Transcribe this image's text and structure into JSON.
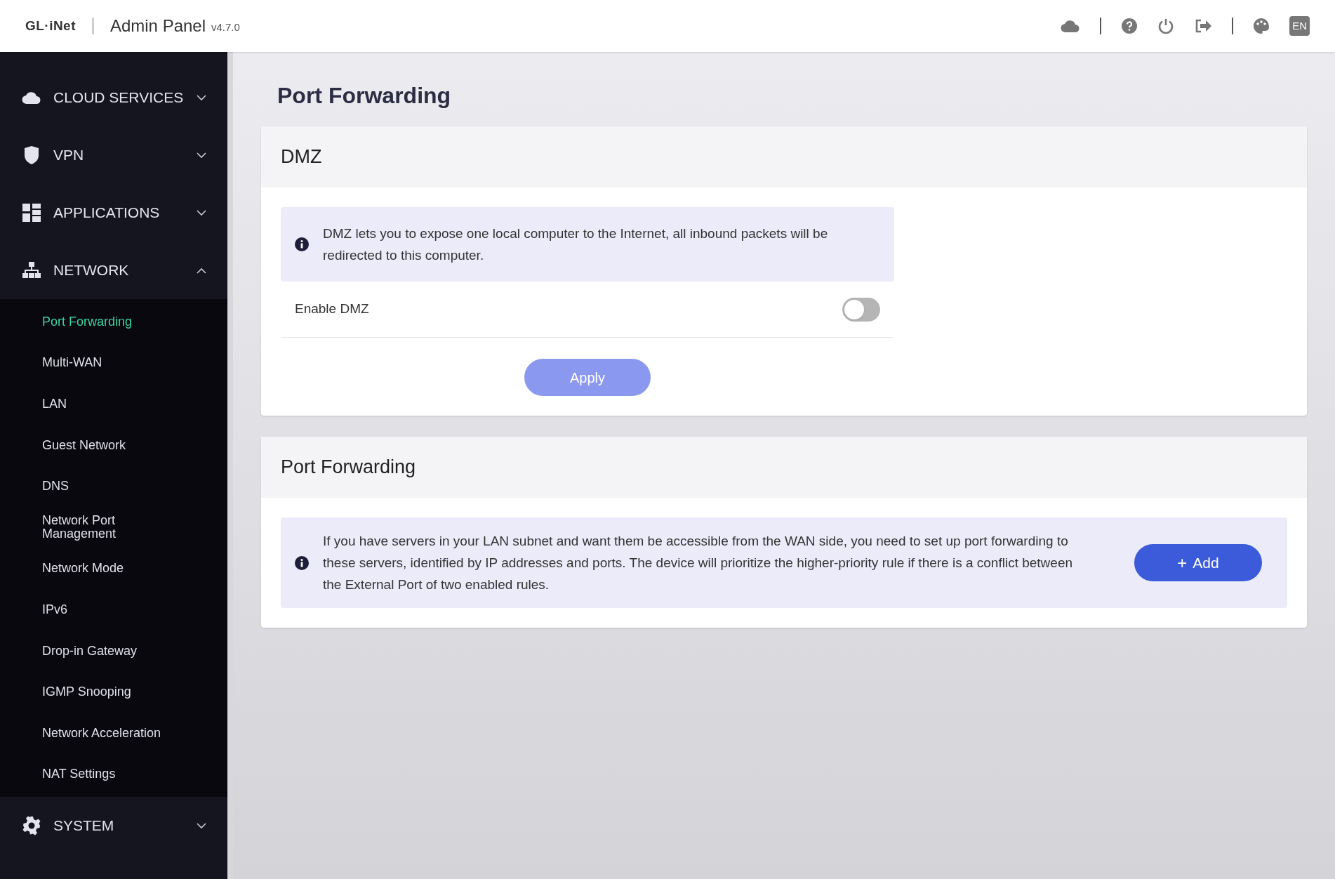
{
  "header": {
    "logo": "GL·iNet",
    "title": "Admin Panel",
    "version": "v4.7.0",
    "language": "EN"
  },
  "sidebar": {
    "groups": [
      {
        "label": "CLOUD SERVICES",
        "expanded": false
      },
      {
        "label": "VPN",
        "expanded": false
      },
      {
        "label": "APPLICATIONS",
        "expanded": false
      },
      {
        "label": "NETWORK",
        "expanded": true,
        "children": [
          {
            "label": "Port Forwarding",
            "selected": true
          },
          {
            "label": "Multi-WAN",
            "selected": false
          },
          {
            "label": "LAN",
            "selected": false
          },
          {
            "label": "Guest Network",
            "selected": false
          },
          {
            "label": "DNS",
            "selected": false
          },
          {
            "label": "Network Port Management",
            "selected": false
          },
          {
            "label": "Network Mode",
            "selected": false
          },
          {
            "label": "IPv6",
            "selected": false
          },
          {
            "label": "Drop-in Gateway",
            "selected": false
          },
          {
            "label": "IGMP Snooping",
            "selected": false
          },
          {
            "label": "Network Acceleration",
            "selected": false
          },
          {
            "label": "NAT Settings",
            "selected": false
          }
        ]
      },
      {
        "label": "SYSTEM",
        "expanded": false
      }
    ]
  },
  "page_title": "Port Forwarding",
  "dmz": {
    "title": "DMZ",
    "info": "DMZ lets you to expose one local computer to the Internet, all inbound packets will be redirected to this computer.",
    "toggle_label": "Enable DMZ",
    "on": false,
    "apply": "Apply",
    "apply_disabled": true
  },
  "port_forwarding": {
    "title": "Port Forwarding",
    "info": "If you have servers in your LAN subnet and want them be accessible from the WAN side, you need to set up port forwarding to these servers, identified by IP addresses and ports. The device will prioritize the higher-priority rule if there is a conflict between the External Port of two enabled rules.",
    "add_icon": "+",
    "add": "Add"
  }
}
